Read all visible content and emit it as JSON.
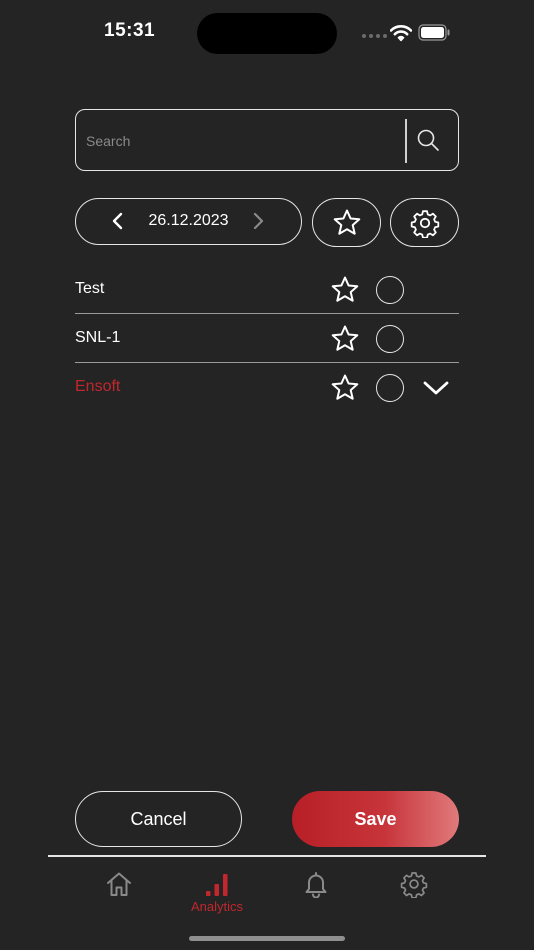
{
  "status_bar": {
    "time": "15:31"
  },
  "search": {
    "placeholder": "Search",
    "value": ""
  },
  "date_nav": {
    "date": "26.12.2023"
  },
  "list": {
    "items": [
      {
        "label": "Test",
        "active": false
      },
      {
        "label": "SNL-1",
        "active": false
      },
      {
        "label": "Ensoft",
        "active": true
      }
    ]
  },
  "actions": {
    "cancel_label": "Cancel",
    "save_label": "Save"
  },
  "tab_bar": {
    "tabs": [
      {
        "icon": "home-icon",
        "label": ""
      },
      {
        "icon": "analytics-icon",
        "label": "Analytics",
        "selected": true
      },
      {
        "icon": "bell-icon",
        "label": ""
      },
      {
        "icon": "gear-icon",
        "label": ""
      }
    ]
  },
  "colors": {
    "background": "#242424",
    "accent": "#c1272d",
    "inactive_icon": "#8a8a8a"
  }
}
